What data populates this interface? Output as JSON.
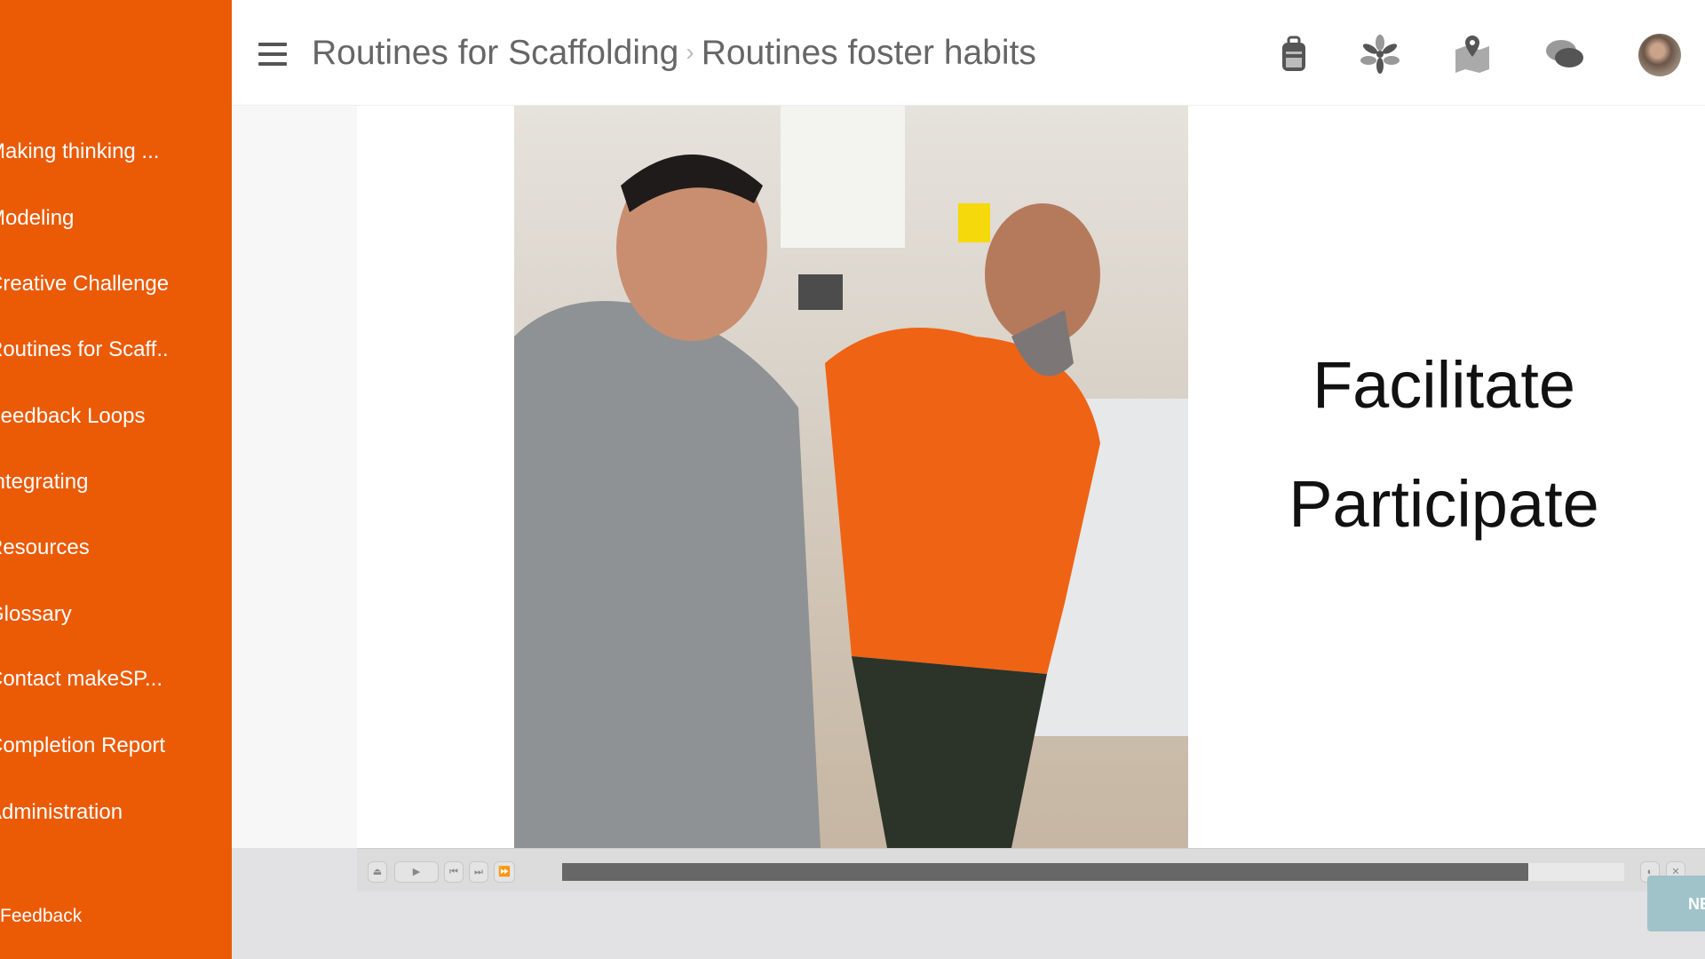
{
  "sidebar": {
    "items": [
      "Making thinking ...",
      "Modeling",
      "Creative Challenge",
      "Routines for Scaff..",
      "Feedback Loops",
      "Integrating",
      "Resources",
      "Glossary",
      "Contact makeSP...",
      "Completion Report",
      "Administration"
    ],
    "feedback": "Feedback"
  },
  "header": {
    "breadcrumb": [
      "Routines for Scaffolding",
      "Routines foster habits"
    ],
    "separator": "›",
    "icons": [
      "backpack-icon",
      "flower-icon",
      "map-pin-icon",
      "chat-icon",
      "avatar"
    ]
  },
  "slide": {
    "words": [
      "Facilitate",
      "Participate"
    ]
  },
  "player": {
    "progress_percent": 91
  },
  "next_label": "NEXT",
  "colors": {
    "sidebar": "#eb5a05",
    "progress": "#676767",
    "next": "#9fc3c8"
  }
}
